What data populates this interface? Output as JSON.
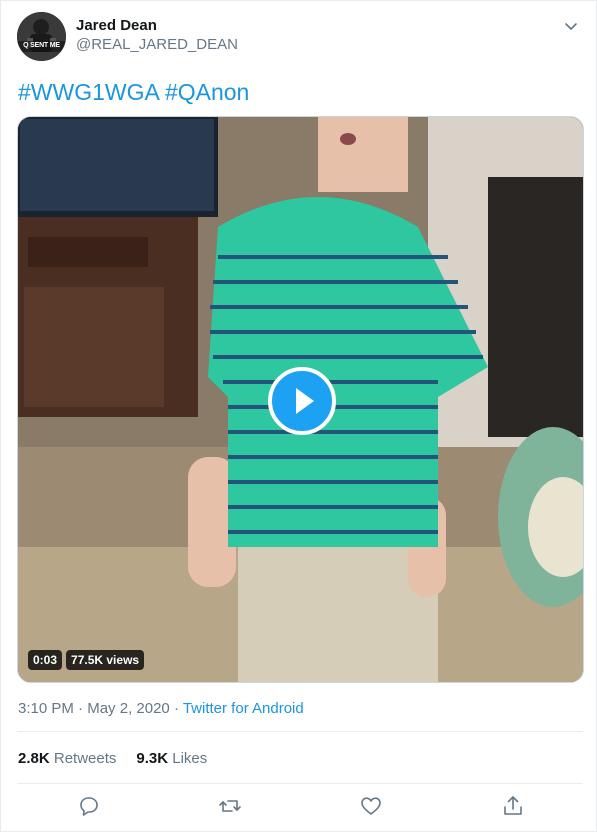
{
  "user": {
    "display_name": "Jared Dean",
    "handle": "@REAL_JARED_DEAN",
    "avatar_text_line1": "Q SENT ME",
    "avatar_text_line2": "WWG1WGA"
  },
  "tweet": {
    "hashtags": [
      "#WWG1WGA",
      "#QAnon"
    ]
  },
  "video": {
    "duration": "0:03",
    "views": "77.5K views"
  },
  "meta": {
    "time": "3:10 PM",
    "separator1": " · ",
    "date": "May 2, 2020",
    "separator2": " · ",
    "source": "Twitter for Android"
  },
  "stats": {
    "retweets_count": "2.8K",
    "retweets_label": " Retweets",
    "likes_count": "9.3K",
    "likes_label": " Likes"
  },
  "actions": [
    "reply-icon",
    "retweet-icon",
    "like-icon",
    "share-icon"
  ],
  "colors": {
    "link": "#1b95e0",
    "secondary_text": "#657786",
    "play_button": "#1da1f2",
    "shirt": "#2fc7a0"
  }
}
